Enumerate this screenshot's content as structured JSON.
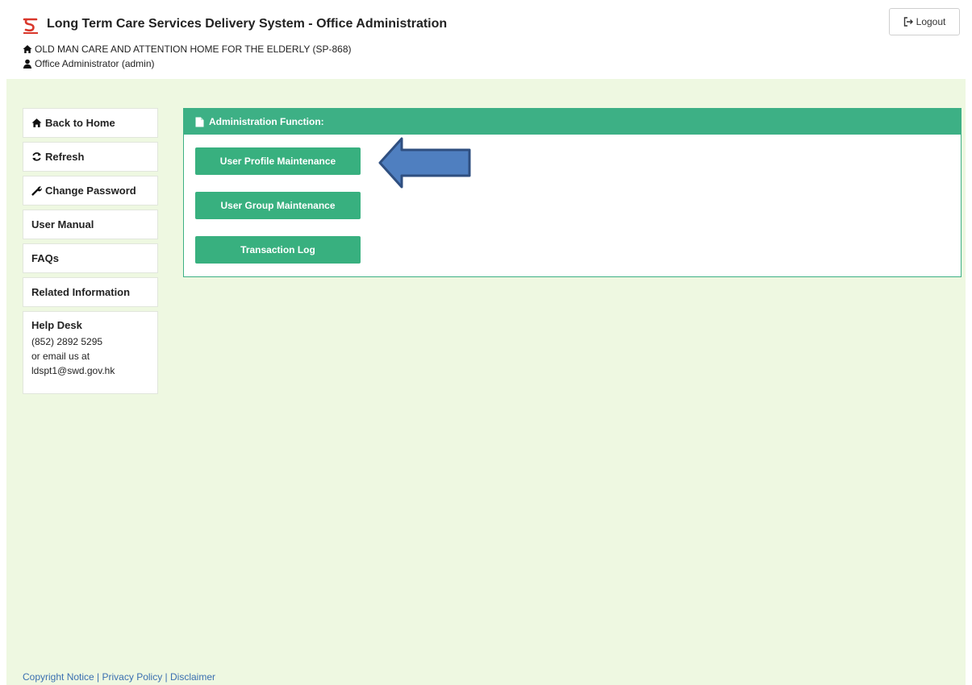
{
  "header": {
    "title": "Long Term Care Services Delivery System - Office Administration",
    "organization": "OLD MAN CARE AND ATTENTION HOME FOR THE ELDERLY (SP-868)",
    "user": "Office Administrator (admin)",
    "logout_label": "Logout"
  },
  "sidebar": {
    "items": [
      {
        "label": "Back to Home",
        "icon": "home-icon"
      },
      {
        "label": "Refresh",
        "icon": "refresh-icon"
      },
      {
        "label": "Change Password",
        "icon": "wrench-icon"
      },
      {
        "label": "User Manual"
      },
      {
        "label": "FAQs"
      },
      {
        "label": "Related Information"
      }
    ],
    "help_desk": {
      "title": "Help Desk",
      "phone": "(852) 2892 5295",
      "email_prefix": "or email us at",
      "email": "ldspt1@swd.gov.hk"
    }
  },
  "panel": {
    "title": "Administration Function:",
    "buttons": [
      "User Profile Maintenance",
      "User Group Maintenance",
      "Transaction Log"
    ]
  },
  "footer": {
    "links": [
      "Copyright Notice",
      "Privacy Policy",
      "Disclaimer"
    ],
    "separator": " | "
  },
  "colors": {
    "accent": "#3db085",
    "page_background": "#eef8e1",
    "arrow": "#4f7fc0",
    "logo": "#d9372b",
    "link": "#3a6fb0"
  }
}
